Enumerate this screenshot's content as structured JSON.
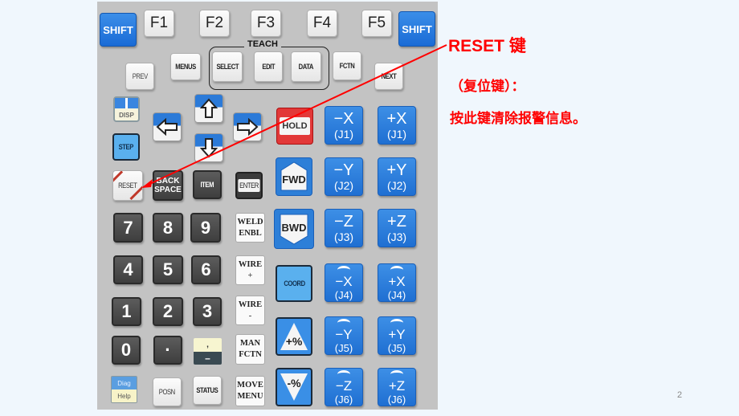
{
  "pendant": {
    "top_row": {
      "shift_left": "SHIFT",
      "f1": "F1",
      "f2": "F2",
      "f3": "F3",
      "f4": "F4",
      "f5": "F5",
      "shift_right": "SHIFT"
    },
    "teach_group_label": "TEACH",
    "second_row": {
      "prev": "PREV",
      "menus": "MENUS",
      "select": "SELECT",
      "edit": "EDIT",
      "data": "DATA",
      "fctn": "FCTN",
      "next": "NEXT"
    },
    "disp": "DISP",
    "step": "STEP",
    "reset": "RESET",
    "backspace_line1": "BACK",
    "backspace_line2": "SPACE",
    "item": "ITEM",
    "enter": "ENTER",
    "hold": "HOLD",
    "fwd": "FWD",
    "bwd": "BWD",
    "coord": "COORD",
    "speed_up": "+%",
    "speed_down": "-%",
    "numpad": [
      "7",
      "8",
      "9",
      "4",
      "5",
      "6",
      "1",
      "2",
      "3",
      "0",
      "·"
    ],
    "comma_minus_top": ",",
    "comma_minus_bottom": "–",
    "weld_enbl": [
      "WELD",
      "ENBL"
    ],
    "wire_plus": [
      "WIRE",
      "+"
    ],
    "wire_minus": [
      "WIRE",
      "-"
    ],
    "man_fctn": [
      "MAN",
      "FCTN"
    ],
    "move_menu": [
      "MOVE",
      "MENU"
    ],
    "diag": "Diag",
    "help": "Help",
    "posn": "POSN",
    "status": "STATUS",
    "jog_keys": [
      {
        "axis": "−X",
        "joint": "(J1)"
      },
      {
        "axis": "+X",
        "joint": "(J1)"
      },
      {
        "axis": "−Y",
        "joint": "(J2)"
      },
      {
        "axis": "+Y",
        "joint": "(J2)"
      },
      {
        "axis": "−Z",
        "joint": "(J3)"
      },
      {
        "axis": "+Z",
        "joint": "(J3)"
      },
      {
        "axis": "−X",
        "joint": "(J4)"
      },
      {
        "axis": "+X",
        "joint": "(J4)"
      },
      {
        "axis": "−Y",
        "joint": "(J5)"
      },
      {
        "axis": "+Y",
        "joint": "(J5)"
      },
      {
        "axis": "−Z",
        "joint": "(J6)"
      },
      {
        "axis": "+Z",
        "joint": "(J6)"
      }
    ]
  },
  "annotation": {
    "title": "RESET 键",
    "subtitle": "（复位键）：",
    "description": "按此键清除报警信息。",
    "color": "#ff0000"
  },
  "slide_number": "2"
}
